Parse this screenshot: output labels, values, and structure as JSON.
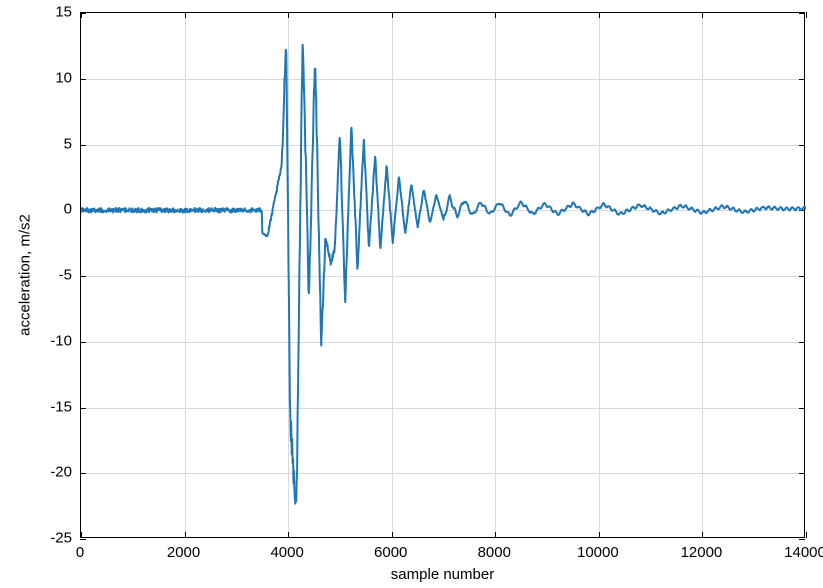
{
  "chart_data": {
    "type": "line",
    "title": "",
    "xlabel": "sample number",
    "ylabel": "acceleration, m/s2",
    "xlim": [
      0,
      14000
    ],
    "ylim": [
      -25,
      15
    ],
    "x_ticks": [
      0,
      2000,
      4000,
      6000,
      8000,
      10000,
      12000,
      14000
    ],
    "y_ticks": [
      -25,
      -20,
      -15,
      -10,
      -5,
      0,
      5,
      10,
      15
    ],
    "grid": true,
    "legend": null,
    "series": [
      {
        "name": "acceleration",
        "color": "#1f77b4",
        "x": [
          0,
          1000,
          2000,
          3000,
          3600,
          3880,
          3960,
          4040,
          4160,
          4280,
          4400,
          4520,
          4640,
          4720,
          4820,
          4900,
          5000,
          5100,
          5220,
          5340,
          5460,
          5560,
          5680,
          5780,
          5900,
          6020,
          6140,
          6260,
          6380,
          6500,
          6620,
          6740,
          6860,
          7000,
          7120,
          7260,
          7400,
          7560,
          7720,
          7900,
          8080,
          8280,
          8500,
          8720,
          8960,
          9200,
          9500,
          9800,
          10100,
          10400,
          10800,
          11200,
          11600,
          12000,
          12400,
          12800,
          13200,
          13600,
          14000
        ],
        "y": [
          0,
          0,
          0,
          0,
          -2.0,
          3.5,
          13.5,
          -16,
          -23,
          14,
          -7,
          12,
          -10.5,
          -2,
          -4,
          -3,
          6,
          -7,
          6.5,
          -4.5,
          5.5,
          -3,
          4.2,
          -3,
          3.4,
          -2.4,
          2.6,
          -1.8,
          2.0,
          -1.3,
          1.6,
          -1.0,
          1.2,
          -0.7,
          1.0,
          -0.5,
          0.8,
          -0.4,
          0.6,
          -0.3,
          0.6,
          -0.4,
          0.6,
          -0.3,
          0.5,
          -0.3,
          0.5,
          -0.3,
          0.45,
          -0.3,
          0.4,
          -0.25,
          0.35,
          -0.2,
          0.3,
          -0.15,
          0.2,
          0.1,
          0.15
        ]
      }
    ]
  },
  "axis": {
    "x_tick_labels": [
      "0",
      "2000",
      "4000",
      "6000",
      "8000",
      "10000",
      "12000",
      "14000"
    ],
    "y_tick_labels": [
      "-25",
      "-20",
      "-15",
      "-10",
      "-5",
      "0",
      "5",
      "10",
      "15"
    ]
  }
}
